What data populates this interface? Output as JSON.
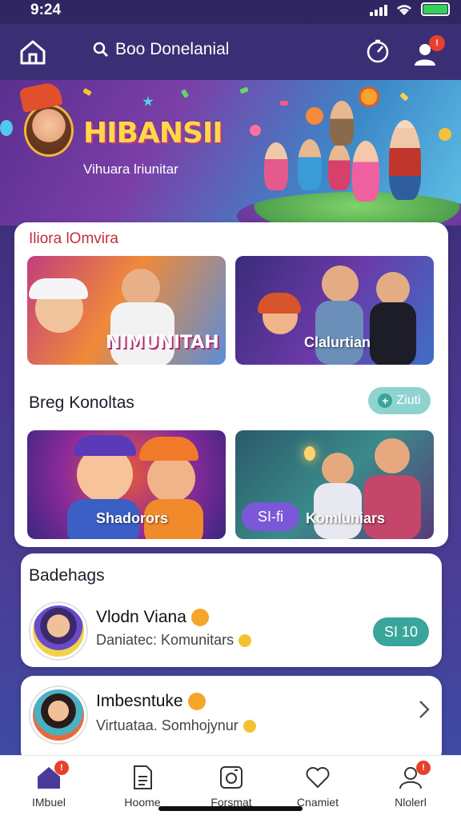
{
  "status": {
    "time": "9:24"
  },
  "header": {
    "search_text": "Boo Donelanial",
    "user_badge": "!"
  },
  "hero": {
    "title": "HIBANSII",
    "subtitle": "Vihuara lriunitar"
  },
  "section1": {
    "title": "Iliora lOmvira",
    "tiles": [
      {
        "label": "NIMUNITAH"
      },
      {
        "label": "Clalurtian"
      }
    ]
  },
  "section2": {
    "title": "Breg Konoltas",
    "action_label": "Ziuti",
    "tiles": [
      {
        "label": "Shadorors"
      },
      {
        "label": "Komluniars",
        "pill": "SI-fi"
      }
    ]
  },
  "featured": {
    "title": "Badehags",
    "item": {
      "name": "Vlodn Viana",
      "subtitle": "Daniatec: Komunitars",
      "button": "SI 10"
    }
  },
  "second_item": {
    "name": "Imbesntuke",
    "subtitle": "Virtuataa. Somhojynur"
  },
  "bottom_nav": {
    "items": [
      {
        "label": "IMbuel",
        "badge": "!"
      },
      {
        "label": "Hoome"
      },
      {
        "label": "Forsmat"
      },
      {
        "label": "Cnamiet"
      },
      {
        "label": "Nlolerl",
        "badge": "!"
      }
    ]
  },
  "colors": {
    "accent": "#3a2f74",
    "brand_red": "#c42e3c",
    "teal": "#3aa59a",
    "purple_pill": "#7a58d8"
  }
}
